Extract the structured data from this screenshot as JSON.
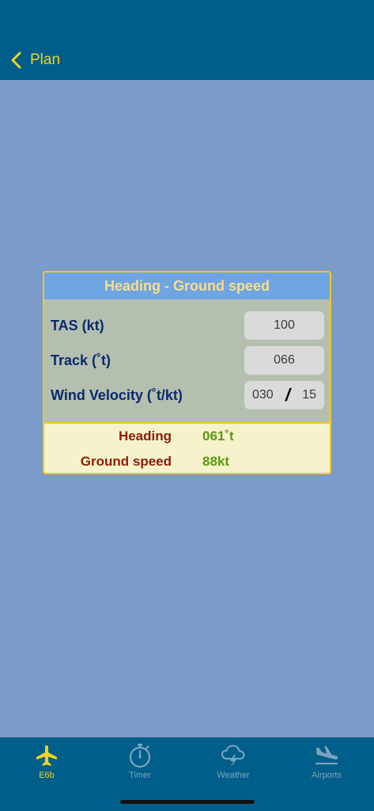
{
  "nav": {
    "back_label": "Plan"
  },
  "card": {
    "title": "Heading - Ground speed",
    "rows": [
      {
        "label": "TAS (kt)",
        "value": "100"
      },
      {
        "label": "Track (˚t)",
        "value": "066"
      },
      {
        "label": "Wind Velocity (˚t/kt)",
        "direction": "030",
        "separator": "/",
        "speed": "15"
      }
    ],
    "results": [
      {
        "label": "Heading",
        "value": "061˚t"
      },
      {
        "label": "Ground speed",
        "value": "88kt"
      }
    ]
  },
  "tabs": [
    {
      "label": "E6b",
      "icon": "airplane-icon",
      "active": true
    },
    {
      "label": "Timer",
      "icon": "stopwatch-icon",
      "active": false
    },
    {
      "label": "Weather",
      "icon": "storm-cloud-icon",
      "active": false
    },
    {
      "label": "Airports",
      "icon": "airplane-landing-icon",
      "active": false
    }
  ],
  "colors": {
    "background": "#7b9bca",
    "bar": "#005f8a",
    "accent": "#f3d21e",
    "header": "#6fa5e3",
    "label": "#0b2a6e",
    "result_label": "#8a1d08",
    "result_value": "#5a9a12",
    "tab_inactive": "#7fa3bd"
  }
}
